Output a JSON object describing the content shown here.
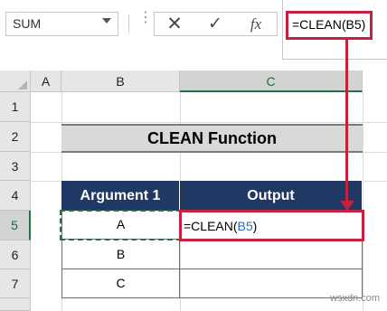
{
  "formula_bar": {
    "name_box": "SUM",
    "cancel_glyph": "✕",
    "enter_glyph": "✓",
    "fx_label": "fx",
    "formula": "=CLEAN(B5)"
  },
  "columns": [
    "A",
    "B",
    "C"
  ],
  "rows": [
    "1",
    "2",
    "3",
    "4",
    "5",
    "6",
    "7"
  ],
  "sheet": {
    "title": "CLEAN Function",
    "headers": {
      "argument": "Argument 1",
      "output": "Output"
    },
    "arguments": [
      "A",
      "B",
      "C"
    ],
    "nonprint_glyph": "",
    "editing_cell": {
      "prefix": "=CLEAN(",
      "ref": "B5",
      "suffix": ")"
    }
  },
  "watermark": "wsxdn.com",
  "colors": {
    "highlight": "#c5203f",
    "header_fill": "#203864",
    "title_fill": "#d9d9d9",
    "selection": "#217346",
    "reference": "#2f6fb6"
  }
}
